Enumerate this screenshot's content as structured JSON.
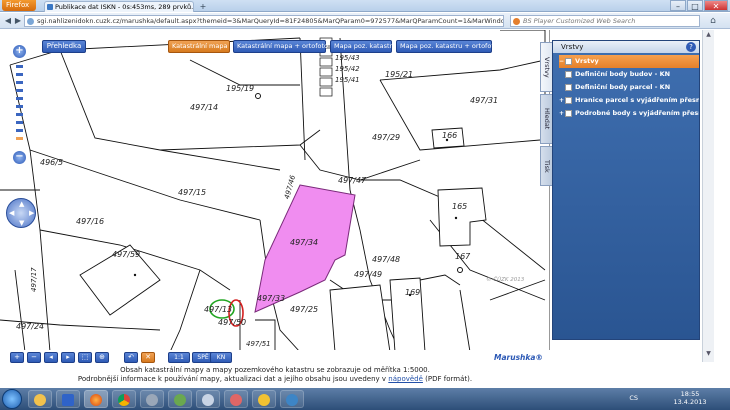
{
  "browser": {
    "app_button": "Firefox",
    "tab_title": "Publikace dat ISKN - 0s:453ms, 289 prvků...",
    "new_tab": "+",
    "url": "sgi.nahlizenidokn.cuzk.cz/marushka/default.aspx?themeid=3&MarQueryId=81F24805&MarQParam0=972577&MarQParamCount=1&MarWindowName",
    "search_placeholder": "BS Player Customized Web Search",
    "window_buttons": [
      "–",
      "□",
      "✕"
    ]
  },
  "map_toolbar": {
    "prehledka_label": "Přehledka",
    "tabs": [
      "Katastrální mapa",
      "Katastrální mapa + ortofoto",
      "Mapa poz. katastru",
      "Mapa poz. katastru + ortofoto"
    ]
  },
  "map": {
    "parcel_labels": [
      "195/43",
      "195/42",
      "195/41",
      "195/19",
      "195/21",
      "497/14",
      "497/31",
      "497/29",
      "496/5",
      "497/47",
      "497/15",
      "497/46",
      "497/34",
      "497/16",
      "497/59",
      "497/48",
      "497/49",
      "497/17",
      "497/13",
      "497/33",
      "497/25",
      "497/24",
      "497/50",
      "497/51"
    ],
    "building_labels": [
      "166",
      "165",
      "167",
      "169"
    ],
    "watermark": "© ČÚZK 2013",
    "highlight_color": "#f08df0"
  },
  "bottom_toolbar": {
    "buttons": [
      "+",
      "−",
      "◂",
      "▸",
      "⬚",
      "⊕",
      "↶",
      "✕"
    ],
    "wide_buttons": [
      "1:1",
      "SPĚ",
      "KN"
    ],
    "brand": "Marushka®"
  },
  "info": {
    "line1": "Obsah katastrální mapy a mapy pozemkového katastru se zobrazuje od měřítka 1:5000.",
    "line2_pre": "Podrobnější informace k používání mapy, aktualizaci dat a jejího obsahu jsou uvedeny v ",
    "line2_link": "nápovědě",
    "line2_post": " (PDF formát)."
  },
  "layers_panel": {
    "title": "Vrstvy",
    "help": "?",
    "side_tabs": [
      "Vrstvy",
      "Hledat",
      "Tisk"
    ],
    "items": [
      {
        "label": "Vrstvy",
        "selected": true,
        "expander": "−"
      },
      {
        "label": "Definiční body budov - KN",
        "selected": false,
        "expander": ""
      },
      {
        "label": "Definiční body parcel - KN",
        "selected": false,
        "expander": ""
      },
      {
        "label": "Hranice parcel s vyjádřením přesnosti - KN",
        "selected": false,
        "expander": "+"
      },
      {
        "label": "Podrobné body s vyjádřením přesnosti - KN",
        "selected": false,
        "expander": "+"
      }
    ]
  },
  "taskbar": {
    "lang": "CS",
    "time": "18:55",
    "date": "13.4.2013"
  }
}
